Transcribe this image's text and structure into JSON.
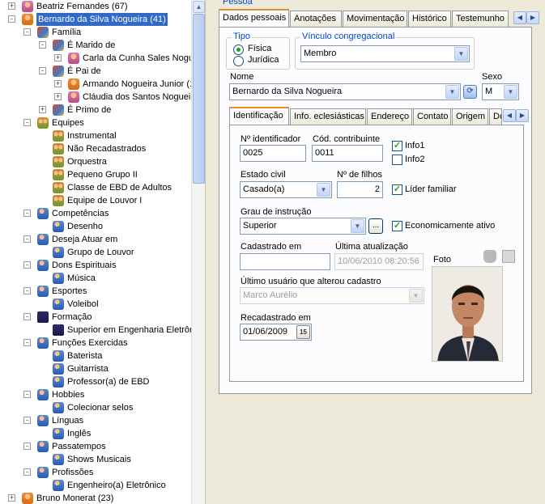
{
  "tree": {
    "nodes": [
      {
        "label": "Beatriz Fernandes (67)",
        "icon": "person-f-icon",
        "toggle": "+"
      },
      {
        "label": "Bernardo da Silva Nogueira (41)",
        "icon": "person-icon",
        "toggle": "−"
      },
      {
        "label": "Família",
        "icon": "family-icon",
        "toggle": "−"
      },
      {
        "label": "É Marido de",
        "icon": "family-icon",
        "toggle": "−"
      },
      {
        "label": "Carla da Cunha Sales Nogue",
        "icon": "person-f-icon",
        "toggle": "+"
      },
      {
        "label": "É Pai de",
        "icon": "family-icon",
        "toggle": "−"
      },
      {
        "label": "Armando Nogueira Junior (1",
        "icon": "person-icon",
        "toggle": "+"
      },
      {
        "label": "Cláudia dos Santos Nogueir",
        "icon": "person-f-icon",
        "toggle": "+"
      },
      {
        "label": "É Primo de",
        "icon": "family-icon",
        "toggle": "+"
      },
      {
        "label": "Equipes",
        "icon": "group-icon",
        "toggle": "−"
      },
      {
        "label": "Instrumental",
        "icon": "group-icon",
        "toggle": ""
      },
      {
        "label": "Não Recadastrados",
        "icon": "group-icon",
        "toggle": ""
      },
      {
        "label": "Orquestra",
        "icon": "group-icon",
        "toggle": ""
      },
      {
        "label": "Pequeno Grupo II",
        "icon": "group-icon",
        "toggle": ""
      },
      {
        "label": "Classe de EBD de Adultos",
        "icon": "group-icon",
        "toggle": ""
      },
      {
        "label": "Equipe de Louvor I",
        "icon": "group-icon",
        "toggle": ""
      },
      {
        "label": "Competências",
        "icon": "category-icon",
        "toggle": "−"
      },
      {
        "label": "Desenho",
        "icon": "category-icon",
        "toggle": ""
      },
      {
        "label": "Deseja Atuar em",
        "icon": "category-icon",
        "toggle": "−"
      },
      {
        "label": "Grupo de Louvor",
        "icon": "category-icon",
        "toggle": ""
      },
      {
        "label": "Dons Espirituais",
        "icon": "category-icon",
        "toggle": "−"
      },
      {
        "label": "Música",
        "icon": "category-icon",
        "toggle": ""
      },
      {
        "label": "Esportes",
        "icon": "category-icon",
        "toggle": "−"
      },
      {
        "label": "Voleibol",
        "icon": "category-icon",
        "toggle": ""
      },
      {
        "label": "Formação",
        "icon": "graduation-icon",
        "toggle": "−"
      },
      {
        "label": "Superior em Engenharia Eletrôni",
        "icon": "graduation-icon",
        "toggle": ""
      },
      {
        "label": "Funções Exercidas",
        "icon": "category-icon",
        "toggle": "−"
      },
      {
        "label": "Baterista",
        "icon": "category-icon",
        "toggle": ""
      },
      {
        "label": "Guitarrista",
        "icon": "category-icon",
        "toggle": ""
      },
      {
        "label": "Professor(a) de EBD",
        "icon": "category-icon",
        "toggle": ""
      },
      {
        "label": "Hobbies",
        "icon": "category-icon",
        "toggle": "−"
      },
      {
        "label": "Colecionar selos",
        "icon": "category-icon",
        "toggle": ""
      },
      {
        "label": "Línguas",
        "icon": "category-icon",
        "toggle": "−"
      },
      {
        "label": "Inglês",
        "icon": "category-icon",
        "toggle": ""
      },
      {
        "label": "Passatempos",
        "icon": "category-icon",
        "toggle": "−"
      },
      {
        "label": "Shows Musicais",
        "icon": "category-icon",
        "toggle": ""
      },
      {
        "label": "Profissões",
        "icon": "category-icon",
        "toggle": "−"
      },
      {
        "label": "Engenheiro(a) Eletrônico",
        "icon": "category-icon",
        "toggle": ""
      },
      {
        "label": "Bruno Monerat (23)",
        "icon": "person-icon",
        "toggle": "+"
      }
    ]
  },
  "pessoa": {
    "group_title": "Pessoa",
    "tabs": [
      "Dados pessoais",
      "Anotações",
      "Movimentação",
      "Histórico",
      "Testemunho"
    ],
    "tipo_legend": "Tipo",
    "tipo_options": [
      "Física",
      "Jurídica"
    ],
    "vinculo_legend": "Vínculo congregacional",
    "vinculo_value": "Membro",
    "nome_label": "Nome",
    "nome_value": "Bernardo da Silva Nogueira",
    "sexo_label": "Sexo",
    "sexo_value": "M",
    "subtabs": [
      "Identificação",
      "Info. eclesiásticas",
      "Endereço",
      "Contato",
      "Origem",
      "Do"
    ],
    "ident": {
      "num_id_label": "Nº identificador",
      "num_id_value": "0025",
      "cod_contrib_label": "Cód. contribuinte",
      "cod_contrib_value": "0011",
      "info1_label": "Info1",
      "info2_label": "Info2",
      "estado_civil_label": "Estado civil",
      "estado_civil_value": "Casado(a)",
      "num_filhos_label": "Nº de filhos",
      "num_filhos_value": "2",
      "lider_label": "Líder familiar",
      "grau_label": "Grau de instrução",
      "grau_value": "Superior",
      "grau_btn": "...",
      "econ_label": "Economicamente ativo",
      "cadastrado_label": "Cadastrado em",
      "cadastrado_value": "",
      "ultima_label": "Última atualização",
      "ultima_value": "10/06/2010 08:20:56",
      "foto_label": "Foto",
      "usuario_label": "Último usuário que alterou cadastro",
      "usuario_value": "Marco Aurélio",
      "recad_label": "Recadastrado em",
      "recad_value": "01/06/2009",
      "cal_btn": "15"
    }
  }
}
